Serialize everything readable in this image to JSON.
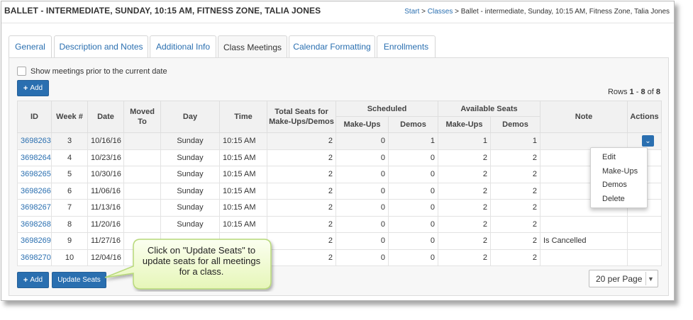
{
  "header": {
    "title": "BALLET - INTERMEDIATE, SUNDAY, 10:15 AM, FITNESS ZONE, TALIA JONES",
    "breadcrumb": {
      "start": "Start",
      "sep1": " > ",
      "classes": "Classes",
      "sep2": " > ",
      "current": "Ballet - intermediate, Sunday, 10:15 AM, Fitness Zone, Talia Jones"
    }
  },
  "tabs": [
    {
      "label": "General"
    },
    {
      "label": "Description and Notes"
    },
    {
      "label": "Additional Info"
    },
    {
      "label": "Class Meetings"
    },
    {
      "label": "Calendar Formatting"
    },
    {
      "label": "Enrollments"
    }
  ],
  "active_tab": "Class Meetings",
  "filters": {
    "show_prior_label": "Show meetings prior to the current date"
  },
  "toolbar": {
    "add_label": "Add",
    "add_icon": "+",
    "update_seats_label": "Update Seats"
  },
  "rows_info": {
    "prefix": "Rows ",
    "from": "1",
    "dash": " - ",
    "to": "8",
    "of_text": " of ",
    "total": "8"
  },
  "table": {
    "headers": {
      "id": "ID",
      "week": "Week #",
      "date": "Date",
      "moved_to": "Moved To",
      "day": "Day",
      "time": "Time",
      "total_seats": "Total Seats for Make-Ups/Demos",
      "scheduled": "Scheduled",
      "available": "Available Seats",
      "makeups": "Make-Ups",
      "demos": "Demos",
      "makeups2": "Make-Ups",
      "demos2": "Demos",
      "note": "Note",
      "actions": "Actions"
    },
    "rows": [
      {
        "id": "3698263",
        "week": "3",
        "date": "10/16/16",
        "moved": "",
        "day": "Sunday",
        "time": "10:15 AM",
        "total": "2",
        "s_mu": "0",
        "s_de": "1",
        "a_mu": "1",
        "a_de": "1",
        "note": ""
      },
      {
        "id": "3698264",
        "week": "4",
        "date": "10/23/16",
        "moved": "",
        "day": "Sunday",
        "time": "10:15 AM",
        "total": "2",
        "s_mu": "0",
        "s_de": "0",
        "a_mu": "2",
        "a_de": "2",
        "note": ""
      },
      {
        "id": "3698265",
        "week": "5",
        "date": "10/30/16",
        "moved": "",
        "day": "Sunday",
        "time": "10:15 AM",
        "total": "2",
        "s_mu": "0",
        "s_de": "0",
        "a_mu": "2",
        "a_de": "2",
        "note": ""
      },
      {
        "id": "3698266",
        "week": "6",
        "date": "11/06/16",
        "moved": "",
        "day": "Sunday",
        "time": "10:15 AM",
        "total": "2",
        "s_mu": "0",
        "s_de": "0",
        "a_mu": "2",
        "a_de": "2",
        "note": ""
      },
      {
        "id": "3698267",
        "week": "7",
        "date": "11/13/16",
        "moved": "",
        "day": "Sunday",
        "time": "10:15 AM",
        "total": "2",
        "s_mu": "0",
        "s_de": "0",
        "a_mu": "2",
        "a_de": "2",
        "note": ""
      },
      {
        "id": "3698268",
        "week": "8",
        "date": "11/20/16",
        "moved": "",
        "day": "Sunday",
        "time": "10:15 AM",
        "total": "2",
        "s_mu": "0",
        "s_de": "0",
        "a_mu": "2",
        "a_de": "2",
        "note": ""
      },
      {
        "id": "3698269",
        "week": "9",
        "date": "11/27/16",
        "moved": "",
        "day": "",
        "time": "",
        "total": "2",
        "s_mu": "0",
        "s_de": "0",
        "a_mu": "2",
        "a_de": "2",
        "note": "Is Cancelled"
      },
      {
        "id": "3698270",
        "week": "10",
        "date": "12/04/16",
        "moved": "",
        "day": "",
        "time": "",
        "total": "2",
        "s_mu": "0",
        "s_de": "0",
        "a_mu": "2",
        "a_de": "2",
        "note": ""
      }
    ]
  },
  "actions_menu": {
    "items": [
      "Edit",
      "Make-Ups",
      "Demos",
      "Delete"
    ]
  },
  "pagination": {
    "per_page_label": "20 per Page"
  },
  "callout": {
    "text": "Click on \"Update Seats\" to update seats for all meetings for a class."
  },
  "icons": {
    "actions_toggle": "chevron-down-icon",
    "dropdown_arrow": "caret-down-icon",
    "add": "plus-icon"
  },
  "colors": {
    "accent": "#2a6fb0",
    "callout_fill": "#f3fbd9",
    "callout_border": "#b8d97a"
  }
}
